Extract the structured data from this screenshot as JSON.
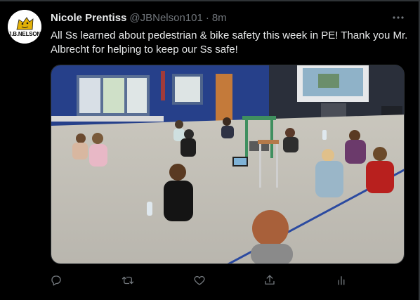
{
  "tweet": {
    "avatar": {
      "logo_text": "J.B.NELSON",
      "icon": "school-mascot-logo"
    },
    "display_name": "Nicole Prentiss",
    "handle": "@JBNelson101",
    "separator": "·",
    "timestamp": "8m",
    "text": "All Ss learned about pedestrian & bike safety this week in PE! Thank you Mr. Albrecht for helping to keep our Ss safe!",
    "media": {
      "description_icon": "gymnasium-photo"
    },
    "actions": [
      {
        "name": "reply",
        "icon": "reply-icon"
      },
      {
        "name": "retweet",
        "icon": "retweet-icon"
      },
      {
        "name": "like",
        "icon": "heart-icon"
      },
      {
        "name": "share",
        "icon": "share-icon"
      },
      {
        "name": "analytics",
        "icon": "analytics-icon"
      }
    ],
    "more_icon": "more-options-icon"
  },
  "colors": {
    "background": "#000000",
    "text_primary": "#e7e9ea",
    "text_secondary": "#71767b",
    "border": "#2f3336"
  }
}
